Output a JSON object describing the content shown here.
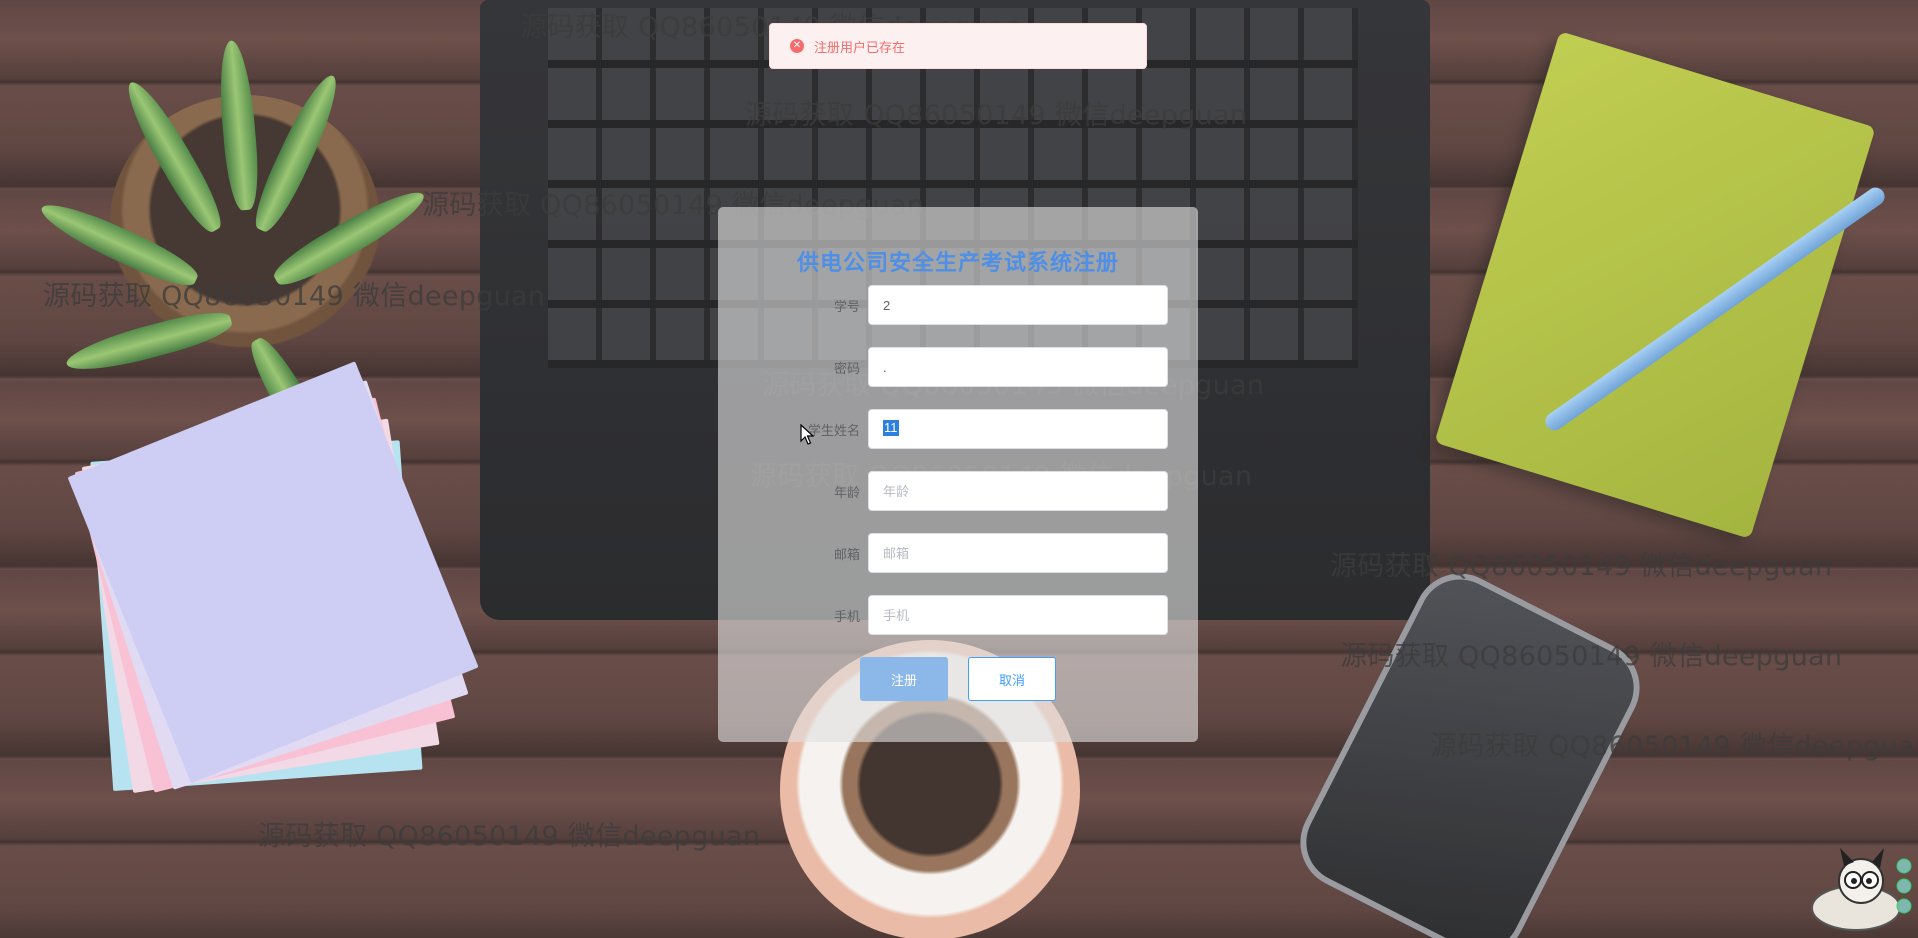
{
  "toast": {
    "icon": "error-circle-icon",
    "message": "注册用户已存在",
    "color": "#f56c6c"
  },
  "form": {
    "title": "供电公司安全生产考试系统注册",
    "fields": [
      {
        "label": "学号",
        "value": "2",
        "placeholder": ""
      },
      {
        "label": "密码",
        "value": ".",
        "placeholder": ""
      },
      {
        "label": "学生姓名",
        "value": "11",
        "placeholder": ""
      },
      {
        "label": "年龄",
        "value": "",
        "placeholder": "年龄"
      },
      {
        "label": "邮箱",
        "value": "",
        "placeholder": "邮箱"
      },
      {
        "label": "手机",
        "value": "",
        "placeholder": "手机"
      }
    ],
    "register_label": "注册",
    "cancel_label": "取消",
    "accent": "#409eff"
  },
  "watermark_text": "源码获取 QQ86050149 微信deepguan"
}
